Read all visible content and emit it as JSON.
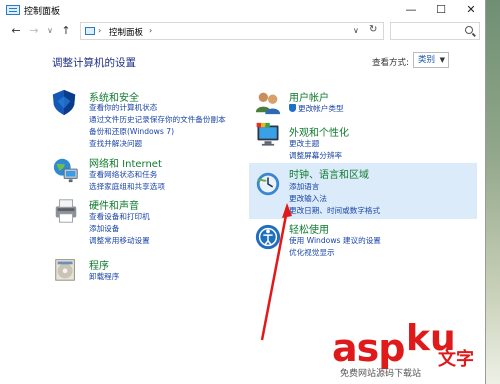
{
  "window": {
    "title": "控制面板"
  },
  "controls": {
    "minimize": "—",
    "maximize": "☐",
    "close": "✕"
  },
  "nav": {
    "back": "←",
    "forward": "→",
    "dropdown": "∨",
    "up": "↑",
    "refresh": "↻"
  },
  "address": {
    "path": "控制面板",
    "chevron_1": "›",
    "chevron_2": "›"
  },
  "main": {
    "heading": "调整计算机的设置",
    "view_by_label": "查看方式:",
    "view_by_value": "类别"
  },
  "categories": {
    "system": {
      "title": "系统和安全",
      "links": [
        "查看你的计算机状态",
        "通过文件历史记录保存你的文件备份副本",
        "备份和还原(Windows 7)",
        "查找并解决问题"
      ]
    },
    "network": {
      "title": "网络和 Internet",
      "links": [
        "查看网络状态和任务",
        "选择家庭组和共享选项"
      ]
    },
    "hardware": {
      "title": "硬件和声音",
      "links": [
        "查看设备和打印机",
        "添加设备",
        "调整常用移动设置"
      ]
    },
    "programs": {
      "title": "程序",
      "links": [
        "卸载程序"
      ]
    },
    "accounts": {
      "title": "用户帐户",
      "links": [
        "更改帐户类型"
      ]
    },
    "appearance": {
      "title": "外观和个性化",
      "links": [
        "更改主题",
        "调整屏幕分辨率"
      ]
    },
    "clock": {
      "title": "时钟、语言和区域",
      "links": [
        "添加语言",
        "更改输入法",
        "更改日期、时间或数字格式"
      ]
    },
    "ease": {
      "title": "轻松使用",
      "links": [
        "使用 Windows 建议的设置",
        "优化视觉显示"
      ]
    }
  },
  "watermark": {
    "brand_a": "asp",
    "brand_b": "ku",
    "suffix": "文字",
    "caption": "免费网站源码下载站"
  },
  "colors": {
    "heading": "#1e3287",
    "category_title": "#0f7a2e",
    "link": "#1a45a8",
    "highlight": "#dcebf9",
    "arrow": "#e01a1a"
  }
}
